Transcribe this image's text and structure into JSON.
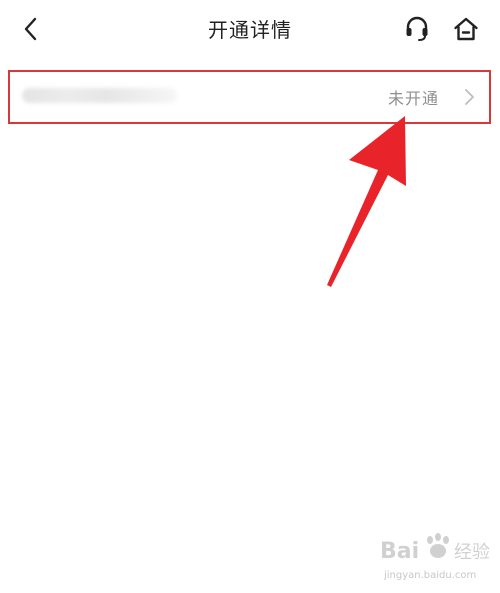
{
  "header": {
    "title": "开通详情",
    "back_icon": "chevron-left-icon",
    "support_icon": "headset-icon",
    "home_icon": "home-icon"
  },
  "service_item": {
    "status": "未开通",
    "chevron_icon": "chevron-right-icon"
  },
  "annotation": {
    "arrow_icon": "red-arrow-icon",
    "highlight_color": "#d9383a"
  },
  "watermark": {
    "logo_text": "Bai 经验",
    "url": "jingyan.baidu.com"
  },
  "colors": {
    "title_text": "#222222",
    "status_text": "#8f8f8f",
    "icon": "#222222",
    "arrow": "#e8242a"
  }
}
